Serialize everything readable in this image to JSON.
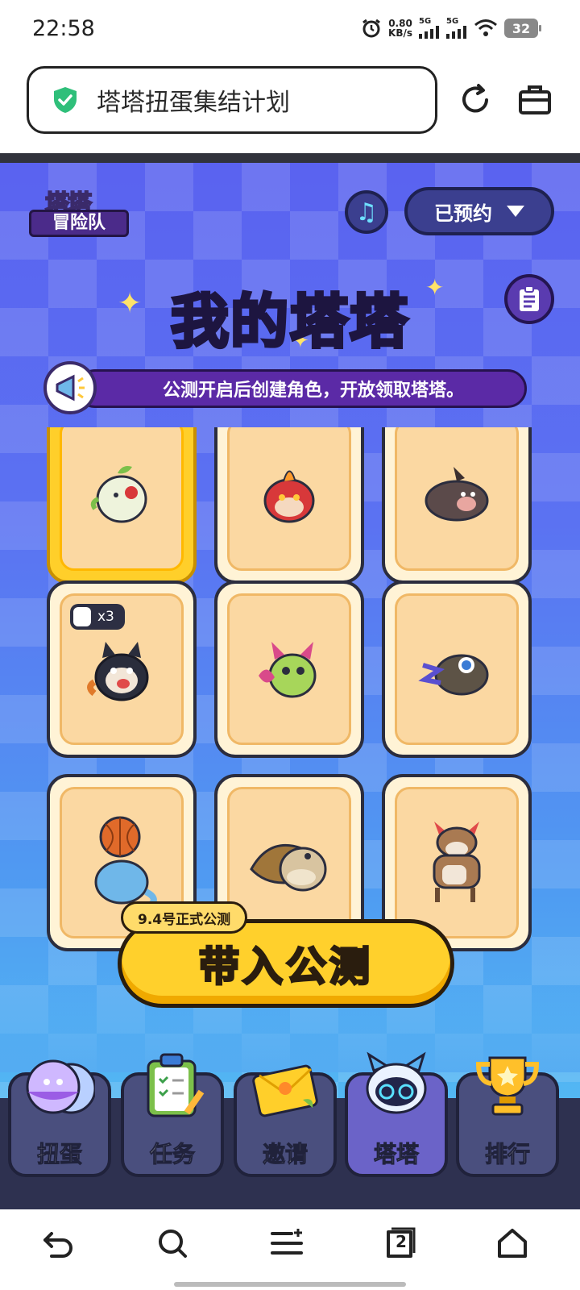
{
  "status_bar": {
    "time": "22:58",
    "net_speed_value": "0.80",
    "net_speed_unit": "KB/s",
    "signal1": "5G",
    "signal2": "5G",
    "battery": "32"
  },
  "browser": {
    "page_title": "塔塔扭蛋集结计划",
    "reload_icon": "reload-icon",
    "toolbox_icon": "toolbox-icon"
  },
  "game": {
    "logo_line1": "塔塔",
    "logo_line2": "冒险队",
    "reserve_label": "已预约",
    "title": "我的塔塔",
    "notice": "公测开启后创建角色，开放领取塔塔。",
    "count_badge": "x3",
    "cta_tag": "9.4号正式公测",
    "cta_label": "带入公测",
    "creatures": [
      {
        "name": "leaf-bird",
        "color": "#e8efd9"
      },
      {
        "name": "fire-bird",
        "color": "#d8383a"
      },
      {
        "name": "boar",
        "color": "#5b4a4a"
      },
      {
        "name": "puppy",
        "color": "#2a2d3c"
      },
      {
        "name": "flower-cat",
        "color": "#a7d65a"
      },
      {
        "name": "lizard",
        "color": "#5d5346"
      },
      {
        "name": "ball-seal",
        "color": "#6fb7e9"
      },
      {
        "name": "turtle",
        "color": "#c9a070"
      },
      {
        "name": "cow",
        "color": "#a97a52"
      }
    ],
    "tabs": [
      {
        "label": "扭蛋",
        "icon": "capsule-icon"
      },
      {
        "label": "任务",
        "icon": "clipboard-icon"
      },
      {
        "label": "邀请",
        "icon": "envelope-icon"
      },
      {
        "label": "塔塔",
        "icon": "robot-icon"
      },
      {
        "label": "排行",
        "icon": "trophy-icon"
      }
    ]
  },
  "nav": {
    "tab_count": "2"
  },
  "colors": {
    "accent_yellow": "#ffd02c",
    "purple": "#5b2aa6"
  }
}
